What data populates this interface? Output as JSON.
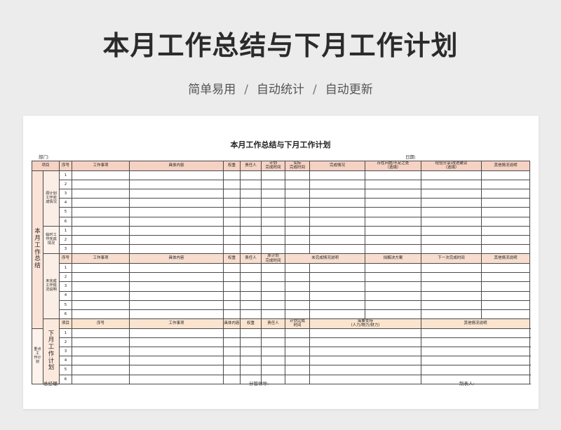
{
  "hero": {
    "title": "本月工作总结与下月工作计划",
    "subtitle": [
      "简单易用",
      "自动统计",
      "自动更新"
    ],
    "separator": "/"
  },
  "sheet": {
    "title": "本月工作总结与下月工作计划",
    "dept_label": "部门:",
    "date_label": "日期:"
  },
  "colors": {
    "header": "#f6d2c4",
    "plan_header": "#fbe4cf",
    "side": "#fbe3d7"
  },
  "table": {
    "header": [
      "项目",
      "序号",
      "工作事项",
      "具体内容",
      "权重",
      "责任人",
      "计划\n完成时间",
      "实际\n完成时间",
      "完成情况",
      "存在问题/不足之处\n（选填）",
      "经验分享/改进建议\n（选填）",
      "其他情况说明"
    ],
    "summary_label": "本\n月\n工\n作\n总\n结",
    "plan_label": "下\n月\n工\n作\n计\n划",
    "group_planned": "原计划\n工作完\n成情况",
    "group_temp": "临时工\n作完成\n情况",
    "group_unfinished": "未完成\n工作情\n况说明",
    "group_key": "重点工\n作计划",
    "unfinished_header": [
      "序号",
      "工作事项",
      "具体内容",
      "权重",
      "责任人",
      "原计划\n完成时间",
      "未完成情况说明",
      "拟解决方案",
      "下一次完成时间",
      "其他情况说明"
    ],
    "plan_header": [
      "项目",
      "序号",
      "工作事项",
      "具体内容",
      "权重",
      "责任人",
      "计划完成\n时间",
      "需要支持\n（人力/物力/财力）",
      "其他情况说明"
    ],
    "rows_planned": [
      "1",
      "2",
      "3",
      "4",
      "5",
      "6"
    ],
    "rows_temp": [
      "1",
      "2",
      "3"
    ],
    "rows_unfinished": [
      "1",
      "2",
      "3",
      "4",
      "5",
      "6"
    ],
    "rows_plan": [
      "1",
      "2",
      "3",
      "4",
      "5",
      "6"
    ]
  },
  "footer": {
    "gm": "总经理:",
    "leader": "分管领导:",
    "maker": "制表人:"
  }
}
